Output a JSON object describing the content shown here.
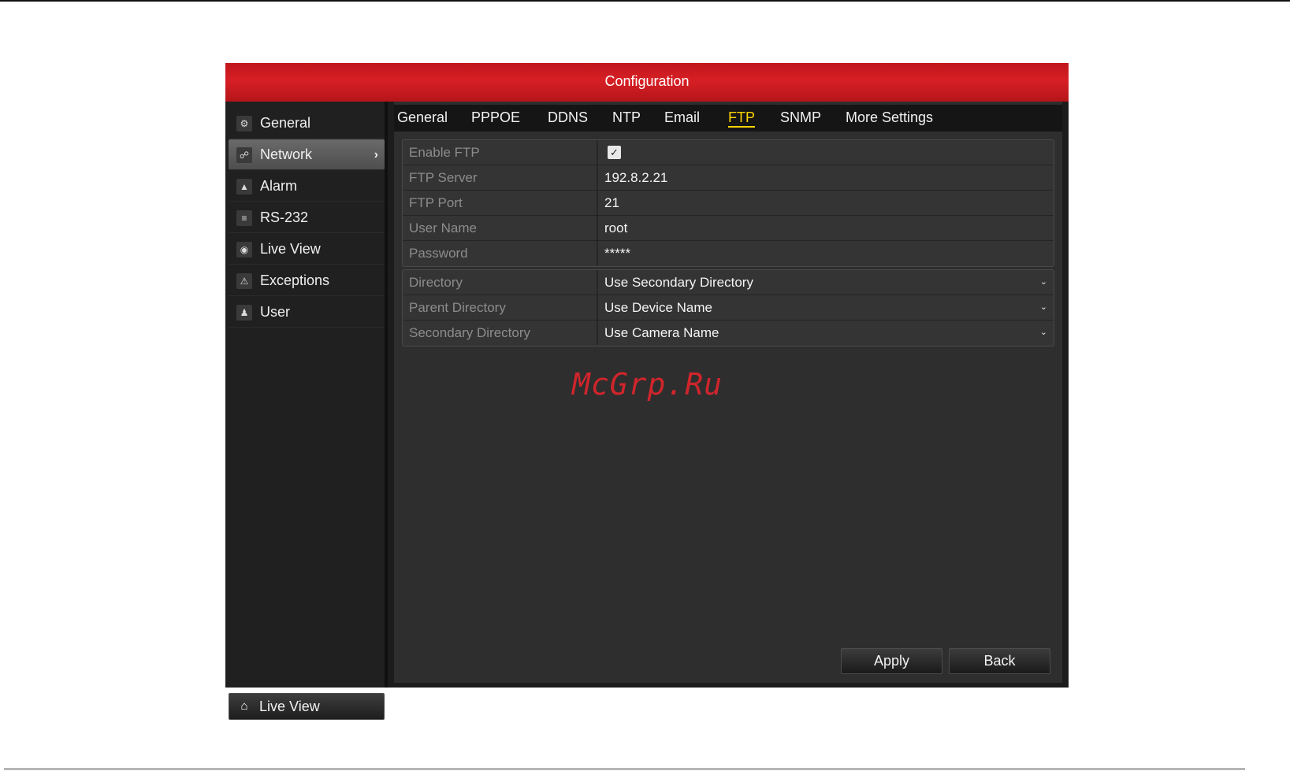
{
  "window": {
    "title": "Configuration"
  },
  "sidebar": {
    "items": [
      {
        "label": "General",
        "icon": "gear-icon",
        "active": false
      },
      {
        "label": "Network",
        "icon": "network-icon",
        "active": true
      },
      {
        "label": "Alarm",
        "icon": "bell-icon",
        "active": false
      },
      {
        "label": "RS-232",
        "icon": "serial-port-icon",
        "active": false
      },
      {
        "label": "Live View",
        "icon": "eye-icon",
        "active": false
      },
      {
        "label": "Exceptions",
        "icon": "warning-icon",
        "active": false
      },
      {
        "label": "User",
        "icon": "users-icon",
        "active": false
      }
    ],
    "live_view_button": "Live View"
  },
  "tabs": [
    {
      "label": "General",
      "active": false
    },
    {
      "label": "PPPOE",
      "active": false
    },
    {
      "label": "DDNS",
      "active": false
    },
    {
      "label": "NTP",
      "active": false
    },
    {
      "label": "Email",
      "active": false
    },
    {
      "label": "FTP",
      "active": true
    },
    {
      "label": "SNMP",
      "active": false
    },
    {
      "label": "More Settings",
      "active": false
    }
  ],
  "ftp": {
    "enable_label": "Enable FTP",
    "enabled": true,
    "server_label": "FTP Server",
    "server_value": "192.8.2.21",
    "port_label": "FTP Port",
    "port_value": "21",
    "username_label": "User Name",
    "username_value": "root",
    "password_label": "Password",
    "password_value": "*****"
  },
  "directory": {
    "directory_label": "Directory",
    "directory_value": "Use Secondary Directory",
    "parent_label": "Parent Directory",
    "parent_value": "Use Device Name",
    "secondary_label": "Secondary Directory",
    "secondary_value": "Use Camera Name"
  },
  "watermark": "McGrp.Ru",
  "buttons": {
    "apply": "Apply",
    "back": "Back"
  },
  "colors": {
    "title_red": "#d71f25",
    "active_tab": "#ffd400",
    "watermark": "#d0252c"
  }
}
